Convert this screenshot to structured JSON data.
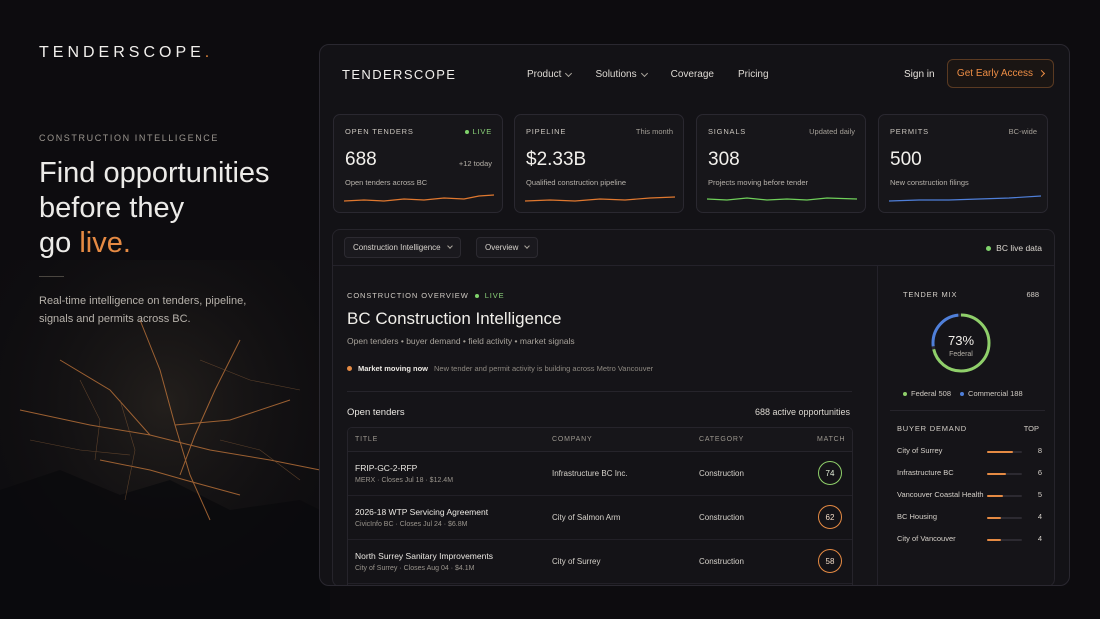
{
  "hero": {
    "logo": "TENDERSCOPE",
    "logo_dot": ".",
    "eyebrow": "CONSTRUCTION INTELLIGENCE",
    "headline_1": "Find opportunities",
    "headline_2": "before they",
    "headline_3": "go ",
    "headline_accent": "live.",
    "subtitle": "Real-time intelligence on tenders, pipeline, signals and permits across BC."
  },
  "nav": {
    "logo": "TENDERSCOPE",
    "links": [
      "Product",
      "Solutions",
      "Coverage",
      "Pricing"
    ],
    "signin": "Sign in",
    "cta": "Get Early Access"
  },
  "stats": [
    {
      "label": "OPEN TENDERS",
      "tag": "LIVE",
      "value": "688",
      "delta": "+12 today",
      "desc": "Open tenders across BC",
      "color": "#e0782f"
    },
    {
      "label": "PIPELINE",
      "tag": "This month",
      "value": "$2.33B",
      "delta": "",
      "desc": "Qualified construction pipeline",
      "color": "#e0782f"
    },
    {
      "label": "SIGNALS",
      "tag": "Updated daily",
      "value": "308",
      "delta": "",
      "desc": "Projects moving before tender",
      "color": "#6fcf5a"
    },
    {
      "label": "PERMITS",
      "tag": "BC-wide",
      "value": "500",
      "delta": "",
      "desc": "New construction filings",
      "color": "#4f7fd9"
    }
  ],
  "toolbar": {
    "dropdown_1": "Construction Intelligence",
    "dropdown_2": "Overview",
    "status": "BC live data"
  },
  "overview": {
    "eyebrow": "CONSTRUCTION OVERVIEW",
    "eyebrow_live": "LIVE",
    "title": "BC Construction Intelligence",
    "subtitle": "Open tenders • buyer demand • field activity • market signals",
    "moving_label": "Market moving now",
    "moving_text": "New tender and permit activity is building across Metro Vancouver"
  },
  "tenders": {
    "heading": "Open tenders",
    "count": "688 active opportunities",
    "columns": [
      "TITLE",
      "COMPANY",
      "CATEGORY",
      "MATCH"
    ],
    "rows": [
      {
        "title": "FRIP-GC-2-RFP",
        "meta": "MERX · Closes Jul 18 · $12.4M",
        "company": "Infrastructure BC Inc.",
        "category": "Construction",
        "match": "74",
        "color": "#8fcf6a"
      },
      {
        "title": "2026-18 WTP Servicing Agreement",
        "meta": "CivicInfo BC · Closes Jul 24 · $6.8M",
        "company": "City of Salmon Arm",
        "category": "Construction",
        "match": "62",
        "color": "#e58a43"
      },
      {
        "title": "North Surrey Sanitary Improvements",
        "meta": "City of Surrey · Closes Aug 04 · $4.1M",
        "company": "City of Surrey",
        "category": "Construction",
        "match": "58",
        "color": "#e58a43"
      }
    ]
  },
  "tender_mix": {
    "heading": "TENDER MIX",
    "total": "688",
    "percent": "73%",
    "percent_label": "Federal",
    "federal_fraction": 0.73,
    "federal_label": "Federal 508",
    "commercial_label": "Commercial 188",
    "federal_color": "#8fcf6a",
    "commercial_color": "#4f7fd9"
  },
  "buyer_demand": {
    "heading": "BUYER DEMAND",
    "right": "TOP",
    "rows": [
      {
        "name": "City of Surrey",
        "count": "8",
        "fraction": 0.75
      },
      {
        "name": "Infrastructure BC",
        "count": "6",
        "fraction": 0.55
      },
      {
        "name": "Vancouver Coastal Health",
        "count": "5",
        "fraction": 0.45
      },
      {
        "name": "BC Housing",
        "count": "4",
        "fraction": 0.4
      },
      {
        "name": "City of Vancouver",
        "count": "4",
        "fraction": 0.4
      }
    ]
  }
}
